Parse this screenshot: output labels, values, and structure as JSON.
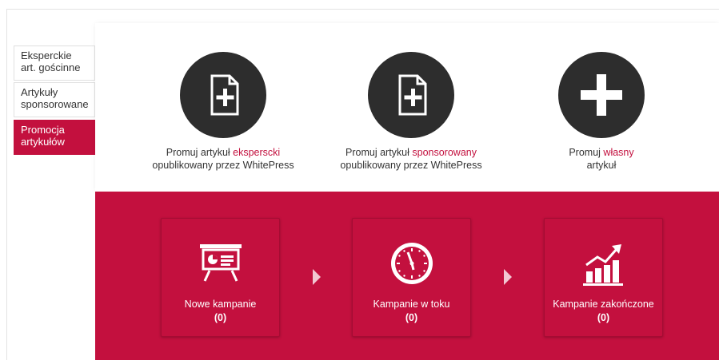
{
  "sidebar": {
    "tabs": [
      {
        "line1": "Eksperckie",
        "line2": "art. gościnne",
        "active": false
      },
      {
        "line1": "Artykuły",
        "line2": "sponsorowane",
        "active": false
      },
      {
        "line1": "Promocja",
        "line2": "artykułów",
        "active": true
      }
    ]
  },
  "options": [
    {
      "pre": "Promuj artykuł ",
      "em": "eksperscki",
      "line2": "opublikowany przez WhitePress",
      "icon": "document-plus-icon"
    },
    {
      "pre": "Promuj artykuł ",
      "em": "sponsorowany",
      "line2": "opublikowany przez WhitePress",
      "icon": "document-plus-icon"
    },
    {
      "pre": "Promuj ",
      "em": "własny",
      "line2": "artykuł",
      "icon": "plus-icon"
    }
  ],
  "campaigns": [
    {
      "name": "Nowe kampanie",
      "count": "(0)",
      "icon": "presentation-board-icon"
    },
    {
      "name": "Kampanie w toku",
      "count": "(0)",
      "icon": "clock-icon"
    },
    {
      "name": "Kampanie zakończone",
      "count": "(0)",
      "icon": "growth-chart-icon"
    }
  ],
  "colors": {
    "accent": "#c3103e",
    "dark": "#2d2d2d"
  }
}
